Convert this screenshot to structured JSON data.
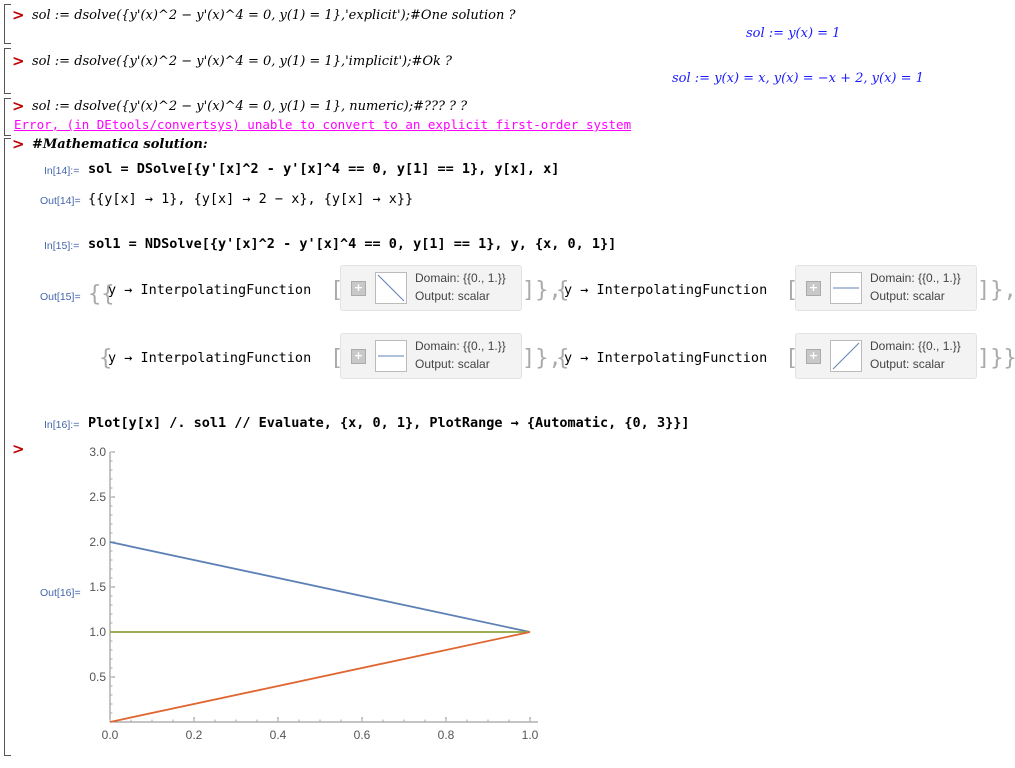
{
  "maple": {
    "line1_input": "sol := dsolve({y'(x)^2 − y'(x)^4 = 0, y(1) = 1},'explicit');#One solution ?",
    "line1_output": "sol := y(x) = 1",
    "line2_input": "sol := dsolve({y'(x)^2 − y'(x)^4 = 0, y(1) = 1},'implicit');#Ok ?",
    "line2_output": "sol := y(x) = x, y(x) = −x + 2, y(x) = 1",
    "line3_input": "sol := dsolve({y'(x)^2 − y'(x)^4 = 0, y(1) = 1}, numeric);#??? ? ?",
    "line3_error": "Error, (in DEtools/convertsys) unable to convert to an explicit first-order system",
    "comment": "#Mathematica solution:",
    "prompt": ">"
  },
  "mathematica": {
    "in14_label": "In[14]:=",
    "in14_code": "sol = DSolve[{y'[x]^2 - y'[x]^4 == 0, y[1] == 1}, y[x], x]",
    "out14_label": "Out[14]=",
    "out14_text": "{{y[x] → 1}, {y[x] → 2 − x}, {y[x] → x}}",
    "in15_label": "In[15]:=",
    "in15_code": "sol1 = NDSolve[{y'[x]^2 - y'[x]^4 == 0, y[1] == 1}, y, {x, 0, 1}]",
    "out15_label": "Out[15]=",
    "interp_text": "y → InterpolatingFunction",
    "domain_text": "Domain: {{0., 1.}}",
    "output_text": "Output: scalar",
    "in16_label": "In[16]:=",
    "in16_code": "Plot[y[x] /. sol1 // Evaluate, {x, 0, 1}, PlotRange → {Automatic, {0, 3}}]",
    "out16_label": "Out[16]="
  },
  "chart_data": {
    "type": "line",
    "xlim": [
      0,
      1
    ],
    "ylim": [
      0,
      3
    ],
    "xticks": [
      "0.0",
      "0.2",
      "0.4",
      "0.6",
      "0.8",
      "1.0"
    ],
    "yticks": [
      "0.5",
      "1.0",
      "1.5",
      "2.0",
      "2.5",
      "3.0"
    ],
    "grid": false,
    "series": [
      {
        "x": [
          0,
          1
        ],
        "y": [
          2,
          1
        ],
        "color": "#5e81b5"
      },
      {
        "x": [
          0,
          1
        ],
        "y": [
          1,
          1
        ],
        "color": "#8fa33b"
      },
      {
        "x": [
          0,
          1
        ],
        "y": [
          0,
          1
        ],
        "color": "#e06632"
      }
    ]
  }
}
